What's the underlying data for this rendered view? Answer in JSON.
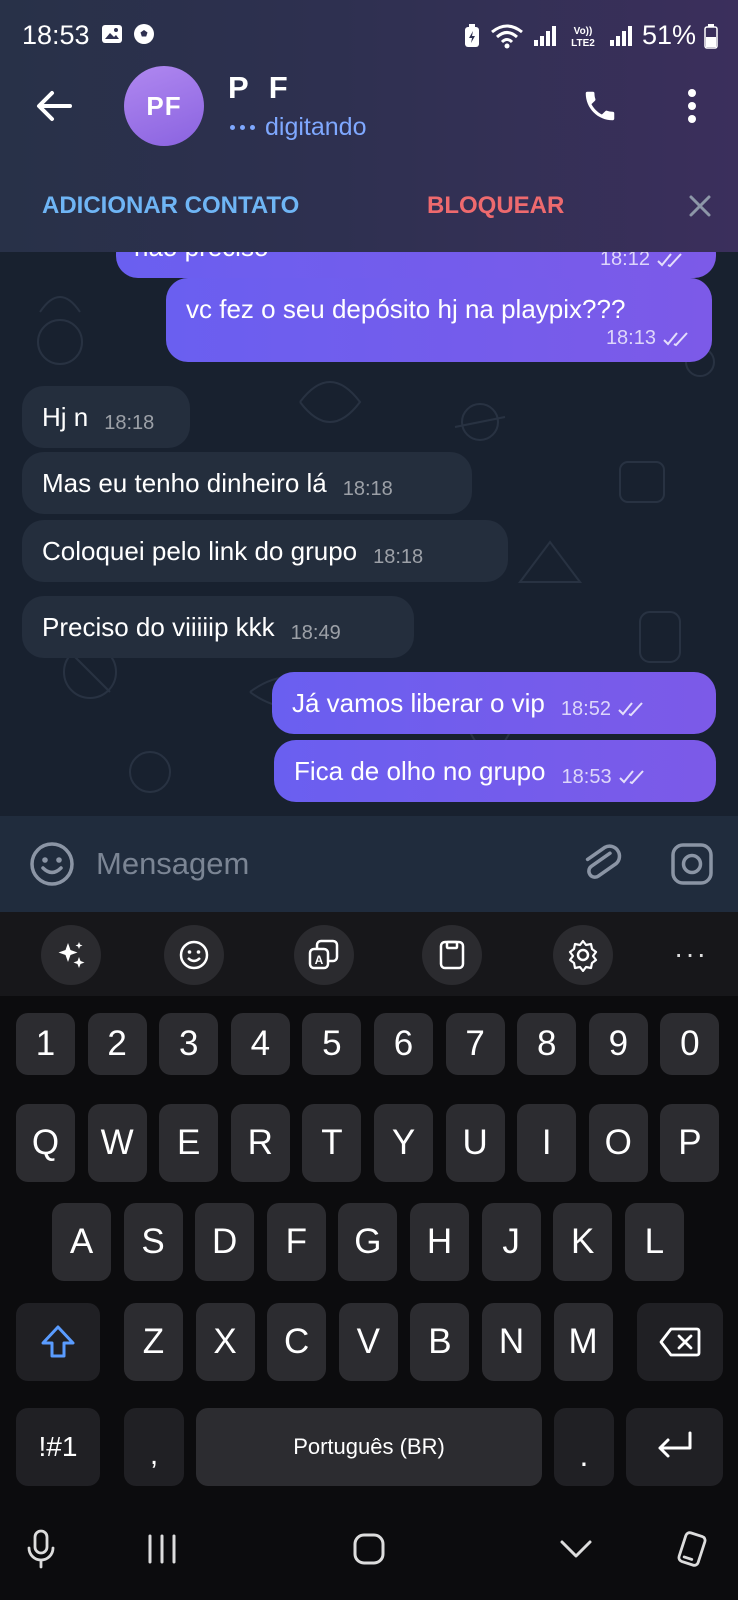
{
  "status_bar": {
    "time": "18:53",
    "battery": "51%",
    "network_label": "Vo)) LTE2"
  },
  "header": {
    "avatar_initials": "PF",
    "contact_name": "P F",
    "contact_status": "digitando",
    "add_contact_label": "ADICIONAR CONTATO",
    "block_label": "BLOQUEAR"
  },
  "messages": [
    {
      "direction": "out",
      "text": "não preciso",
      "time": "18:12",
      "read": true,
      "partial": true
    },
    {
      "direction": "out",
      "text": "vc fez o seu depósito hj na playpix???",
      "time": "18:13",
      "read": true
    },
    {
      "direction": "in",
      "text": "Hj n",
      "time": "18:18"
    },
    {
      "direction": "in",
      "text": "Mas eu tenho dinheiro lá",
      "time": "18:18"
    },
    {
      "direction": "in",
      "text": "Coloquei pelo link do grupo",
      "time": "18:18"
    },
    {
      "direction": "in",
      "text": "Preciso do viiiiip kkk",
      "time": "18:49"
    },
    {
      "direction": "out",
      "text": "Já vamos liberar o vip",
      "time": "18:52",
      "read": true
    },
    {
      "direction": "out",
      "text": "Fica de olho no grupo",
      "time": "18:53",
      "read": true
    }
  ],
  "input": {
    "placeholder": "Mensagem",
    "value": ""
  },
  "keyboard": {
    "toolbar_icons": [
      "sparkle-icon",
      "emoji-icon",
      "translate-icon",
      "clipboard-icon",
      "settings-icon"
    ],
    "toolbar_more": "···",
    "row_numbers": [
      "1",
      "2",
      "3",
      "4",
      "5",
      "6",
      "7",
      "8",
      "9",
      "0"
    ],
    "row_1": [
      "Q",
      "W",
      "E",
      "R",
      "T",
      "Y",
      "U",
      "I",
      "O",
      "P"
    ],
    "row_2": [
      "A",
      "S",
      "D",
      "F",
      "G",
      "H",
      "J",
      "K",
      "L"
    ],
    "row_3": [
      "Z",
      "X",
      "C",
      "V",
      "B",
      "N",
      "M"
    ],
    "symbols_key": "!#1",
    "comma_key": ",",
    "space_label": "Português (BR)",
    "period_key": "."
  },
  "colors": {
    "accent_blue": "#6fb5f5",
    "block_red": "#ee6a6e",
    "outgoing_bubble": "#6a5ff0",
    "incoming_bubble": "#242e3d",
    "chat_bg": "#18212f"
  }
}
